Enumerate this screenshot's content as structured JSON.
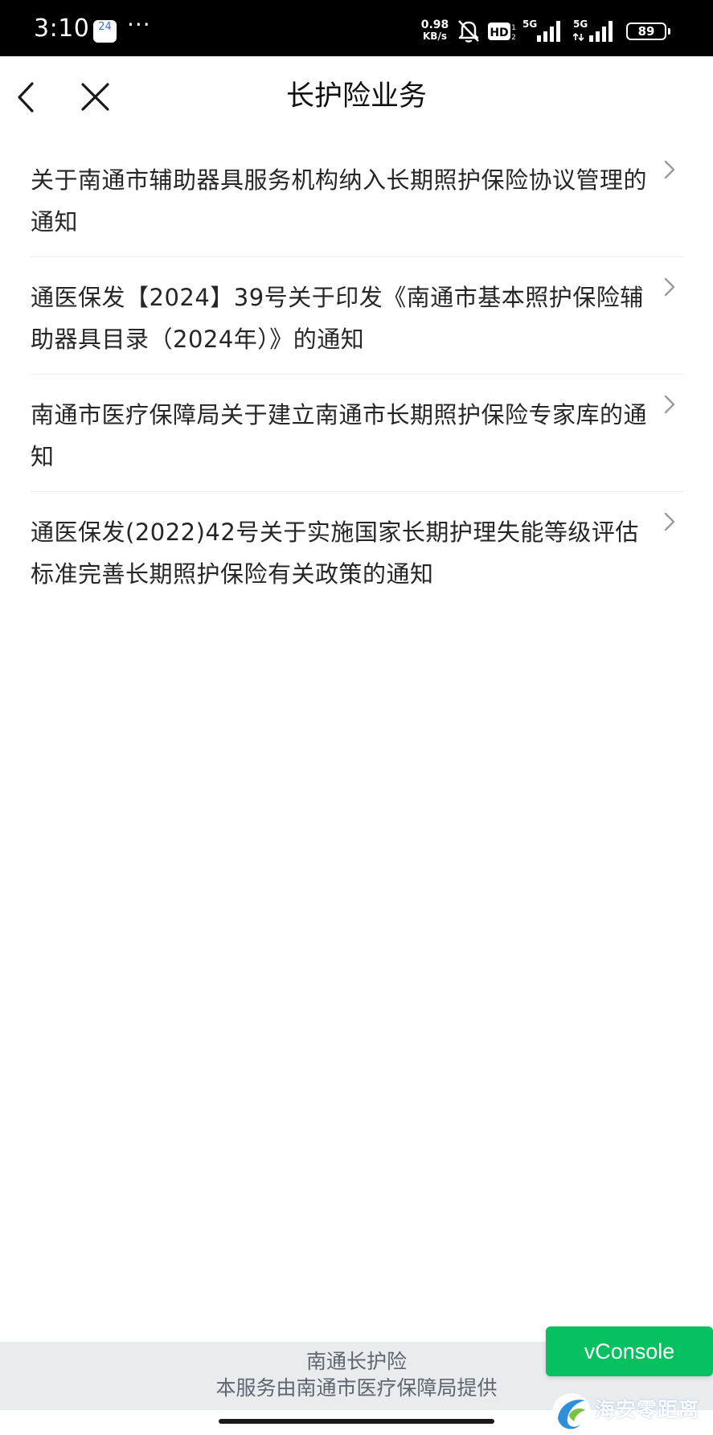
{
  "status_bar": {
    "time": "3:10",
    "calendar_day": "24",
    "more": "···",
    "net_speed_value": "0.98",
    "net_speed_unit": "KB/s",
    "hd_label": "HD",
    "signal_1_label": "5G",
    "signal_2_label": "5G",
    "battery": "89",
    "icons": [
      "calendar-icon",
      "more-dots-icon",
      "mute-bell-icon",
      "hd-icon",
      "signal-icon",
      "battery-icon"
    ]
  },
  "nav": {
    "title": "长护险业务",
    "back_icon": "chevron-left-icon",
    "close_icon": "close-icon"
  },
  "notices": [
    {
      "title": "关于南通市辅助器具服务机构纳入长期照护保险协议管理的通知"
    },
    {
      "title": "通医保发【2024】39号关于印发《南通市基本照护保险辅助器具目录（2024年）》的通知"
    },
    {
      "title": "南通市医疗保障局关于建立南通市长期照护保险专家库的通知"
    },
    {
      "title": "通医保发(2022)42号关于实施国家长期护理失能等级评估标准完善长期照护保险有关政策的通知"
    }
  ],
  "footer": {
    "line1": "南通长护险",
    "line2": "本服务由南通市医疗保障局提供"
  },
  "vconsole": {
    "label": "vConsole",
    "color": "#07c160"
  },
  "watermark": {
    "text": "海安零距离"
  },
  "colors": {
    "status_bar_bg": "#000000",
    "page_bg": "#ffffff",
    "footer_bg": "#e9ecef",
    "accent": "#07c160"
  }
}
